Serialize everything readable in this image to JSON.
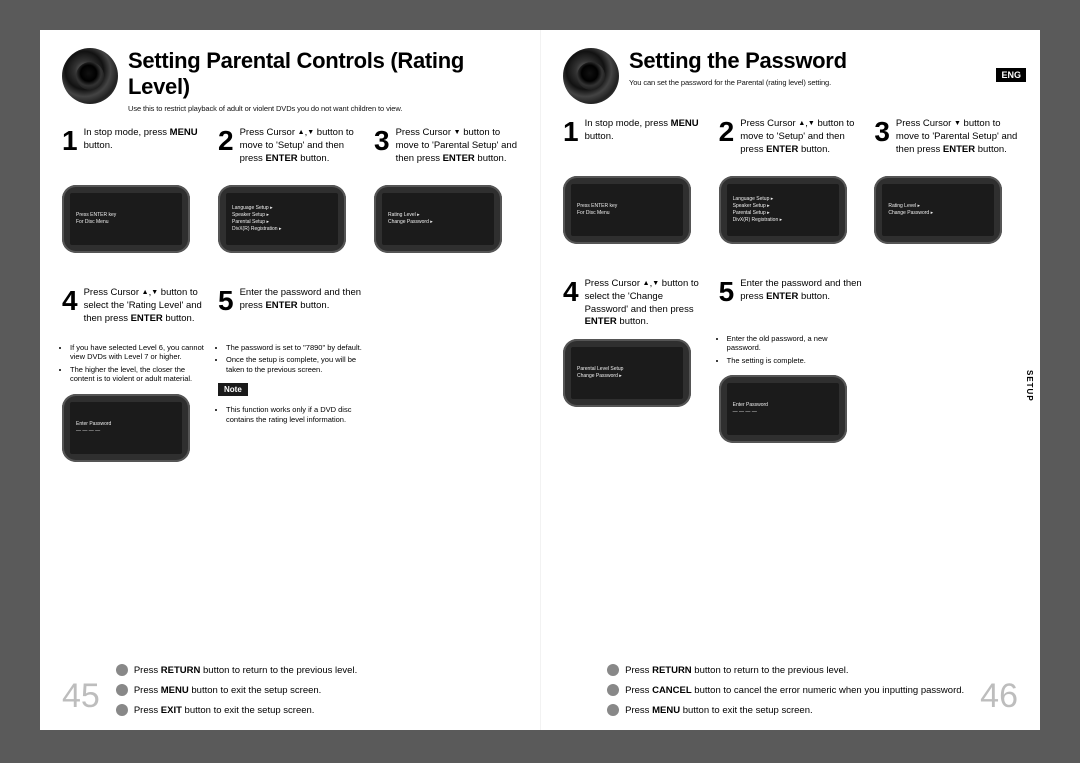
{
  "lang_badge": "ENG",
  "side_tab": "SETUP",
  "left": {
    "title": "Setting Parental Controls (Rating Level)",
    "subtitle": "Use this to restrict playback of adult or violent DVDs you do not want children to view.",
    "steps": [
      {
        "num": "1",
        "html": "In stop mode, press <b>MENU</b> button.",
        "screen": [
          "Press ENTER key",
          "For Disc Menu"
        ]
      },
      {
        "num": "2",
        "html": "Press Cursor <span class='tri-up'></span>,<span class='tri-dn'></span> button to move to 'Setup' and then press <b>ENTER</b> button.",
        "screen": [
          "Language Setup ▸",
          "Speaker Setup ▸",
          "Parental Setup ▸",
          "DivX(R) Registration ▸"
        ]
      },
      {
        "num": "3",
        "html": "Press Cursor <span class='tri-dn'></span> button to move to 'Parental Setup' and then press <b>ENTER</b> button.",
        "screen": [
          "Rating Level ▸",
          "Change Password ▸"
        ]
      },
      {
        "num": "4",
        "html": "Press Cursor <span class='tri-up'></span>,<span class='tri-dn'></span> button to select the 'Rating Level' and then press <b>ENTER</b> button.",
        "bullets": [
          "If you have selected Level 6, you cannot view DVDs with Level 7 or higher.",
          "The higher the level, the closer the content is to violent or adult material."
        ],
        "screen": [
          "Enter Password",
          "— — — —"
        ]
      },
      {
        "num": "5",
        "html": "Enter the password and then press <b>ENTER</b> button.",
        "bullets": [
          "The password is set to \"7890\" by default.",
          "Once the setup is complete, you will be taken to the previous screen."
        ],
        "note_label": "Note",
        "note_bullets": [
          "This function works only if a DVD disc contains the rating level information."
        ]
      }
    ],
    "return_lines": [
      "Press <b>RETURN</b> button to return to the previous level.",
      "Press <b>MENU</b> button to exit the setup screen.",
      "Press <b>EXIT</b> button to exit the setup screen."
    ],
    "page_number": "45"
  },
  "right": {
    "title": "Setting the Password",
    "subtitle": "You can set the password for the Parental (rating level) setting.",
    "steps": [
      {
        "num": "1",
        "html": "In stop mode, press <b>MENU</b> button.",
        "screen": [
          "Press ENTER key",
          "For Disc Menu"
        ]
      },
      {
        "num": "2",
        "html": "Press Cursor <span class='tri-up'></span>,<span class='tri-dn'></span> button to move to 'Setup' and then press <b>ENTER</b> button.",
        "screen": [
          "Language Setup ▸",
          "Speaker Setup ▸",
          "Parental Setup ▸",
          "DivX(R) Registration ▸"
        ]
      },
      {
        "num": "3",
        "html": "Press Cursor <span class='tri-dn'></span> button to move to 'Parental Setup' and then press <b>ENTER</b> button.",
        "screen": [
          "Rating Level ▸",
          "Change Password ▸"
        ]
      },
      {
        "num": "4",
        "html": "Press Cursor <span class='tri-up'></span>,<span class='tri-dn'></span> button to select the 'Change Password' and then press <b>ENTER</b> button.",
        "screen": [
          "Parental Level   Setup",
          "Change Password ▸"
        ]
      },
      {
        "num": "5",
        "html": "Enter the password and then press <b>ENTER</b> button.",
        "bullets": [
          "Enter the old password, a new password.",
          "The setting is complete."
        ],
        "screen": [
          "Enter Password",
          "— — — —"
        ]
      }
    ],
    "return_lines": [
      "Press <b>RETURN</b> button to return to the previous level.",
      "Press <b>CANCEL</b> button to cancel the error numeric when you inputting password.",
      "Press <b>MENU</b> button to exit the setup screen."
    ],
    "page_number": "46"
  }
}
